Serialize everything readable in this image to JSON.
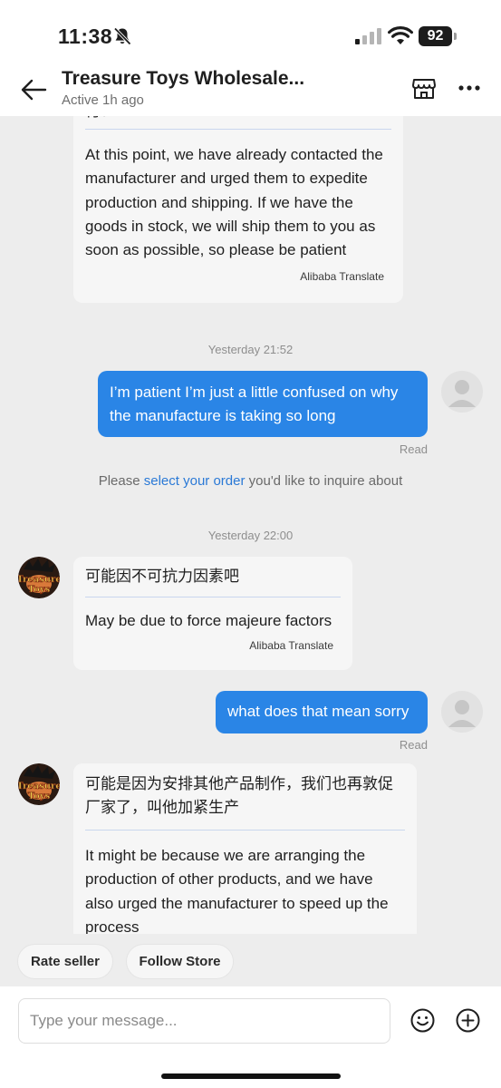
{
  "status_bar": {
    "time": "11:38",
    "battery": "92"
  },
  "header": {
    "title": "Treasure Toys Wholesale...",
    "status": "Active 1h ago"
  },
  "messages": [
    {
      "direction": "incoming",
      "original_partial": "付？",
      "translation": [
        "At this point, we have already contacted the",
        "manufacturer and urged them to expedite",
        "production and shipping. If we have the",
        "goods in stock, we will ship them to you as",
        "soon as possible, so please be patient"
      ],
      "translate_tag": "Alibaba Translate"
    },
    {
      "type": "timestamp",
      "text": "Yesterday 21:52"
    },
    {
      "direction": "outgoing",
      "text": [
        "I’m patient I’m just a little confused on why",
        "the manufacture is taking so long"
      ],
      "read": "Read"
    },
    {
      "type": "system",
      "prefix": "Please ",
      "link": "select your order",
      "suffix": " you'd like to inquire about"
    },
    {
      "type": "timestamp",
      "text": "Yesterday 22:00"
    },
    {
      "direction": "incoming",
      "original": "可能因不可抗力因素吧",
      "translation": "May be due to force majeure factors",
      "translate_tag": "Alibaba Translate"
    },
    {
      "direction": "outgoing",
      "text": "what does that mean sorry",
      "read": "Read"
    },
    {
      "direction": "incoming",
      "original": [
        "可能是因为安排其他产品制作，我们也再敦促",
        "厂家了，叫他加紧生产"
      ],
      "translation": [
        "It might be because we are arranging the",
        "production of other products, and we have",
        "also urged the manufacturer to speed up the",
        "process"
      ]
    }
  ],
  "seller_avatar_text": [
    "Treasure",
    "Toys"
  ],
  "quick_actions": [
    "Rate seller",
    "Follow Store"
  ],
  "composer": {
    "placeholder": "Type your message..."
  },
  "colors": {
    "accent": "#2a85e6",
    "link": "#2a79d6",
    "background": "#ededed"
  }
}
